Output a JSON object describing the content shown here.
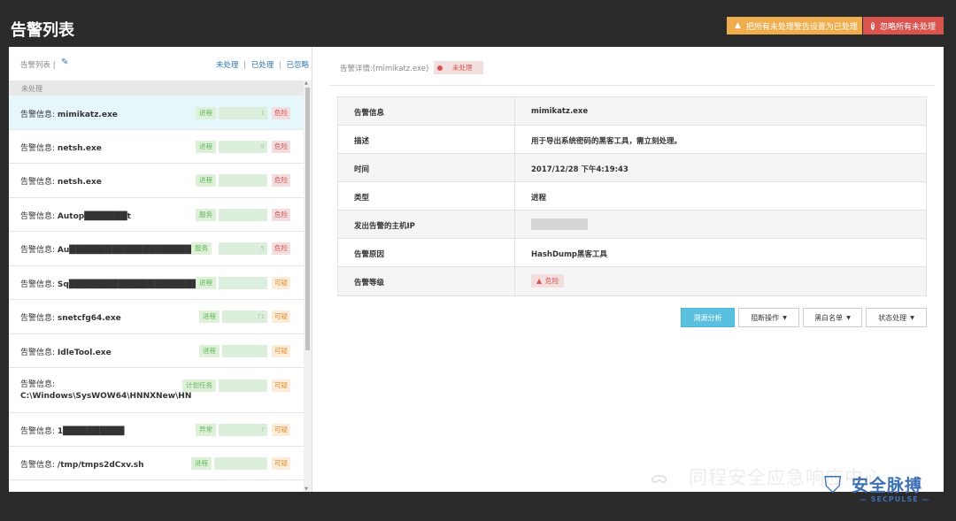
{
  "page": {
    "title": "告警列表"
  },
  "top_buttons": {
    "mark_all": "把所有未处理警告设置为已处理",
    "ignore_all": "忽略所有未处理"
  },
  "left": {
    "title": "告警列表 |",
    "filters": {
      "unhandled": "未处理",
      "handled": "已处理",
      "ignored": "已忽略",
      "sep": "|"
    },
    "section": "未处理",
    "items": [
      {
        "prefix": "告警信息: ",
        "name": "mimikatz.exe",
        "type": "进程",
        "blur_text": "1",
        "level": "危险",
        "level_kind": "high"
      },
      {
        "prefix": "告警信息: ",
        "name": "netsh.exe",
        "type": "进程",
        "blur_text": "9",
        "level": "危险",
        "level_kind": "high"
      },
      {
        "prefix": "告警信息: ",
        "name": "netsh.exe",
        "type": "进程",
        "blur_text": "",
        "level": "危险",
        "level_kind": "high"
      },
      {
        "prefix": "告警信息: ",
        "name": "Autop███████t",
        "type": "服务",
        "blur_text": "",
        "level": "危险",
        "level_kind": "high"
      },
      {
        "prefix": "告警信息: ",
        "name": "Au████████████████████g",
        "type": "服务",
        "blur_text": "5",
        "level": "危险",
        "level_kind": "high"
      },
      {
        "prefix": "告警信息: ",
        "name": "Sq██████████████████████e",
        "type": "进程",
        "blur_text": "",
        "level": "可疑",
        "level_kind": "mid"
      },
      {
        "prefix": "告警信息: ",
        "name": "snetcfg64.exe",
        "type": "进程",
        "blur_text": "71",
        "level": "可疑",
        "level_kind": "mid"
      },
      {
        "prefix": "告警信息: ",
        "name": "IdleTool.exe",
        "type": "进程",
        "blur_text": "",
        "level": "可疑",
        "level_kind": "mid"
      },
      {
        "prefix": "告警信息: ",
        "name": "C:\\Windows\\SysWOW64\\HNNXNew\\HN",
        "type": "计划任务",
        "blur_text": "",
        "level": "可疑",
        "level_kind": "mid"
      },
      {
        "prefix": "告警信息: ",
        "name": "1██████████",
        "type": "异常",
        "blur_text": "7",
        "level": "可疑",
        "level_kind": "mid"
      },
      {
        "prefix": "告警信息: ",
        "name": "/tmp/tmps2dCxv.sh",
        "type": "进程",
        "blur_text": "",
        "level": "可疑",
        "level_kind": "mid"
      }
    ]
  },
  "detail": {
    "header": "告警详情:(mimikatz.exe)",
    "status": "未处理",
    "rows": [
      {
        "key": "告警信息",
        "value": "mimikatz.exe"
      },
      {
        "key": "描述",
        "value": "用于导出系统密码的黑客工具，需立刻处理。"
      },
      {
        "key": "时间",
        "value": "2017/12/28 下午4:19:43"
      },
      {
        "key": "类型",
        "value": "进程"
      },
      {
        "key": "发出告警的主机IP",
        "value": ""
      },
      {
        "key": "告警原因",
        "value": "HashDump黑客工具"
      },
      {
        "key": "告警等级",
        "value": "危险"
      }
    ],
    "actions": {
      "trace": "溯源分析",
      "block": "阻断操作",
      "list": "黑白名单",
      "status": "状态处理"
    }
  },
  "watermark": {
    "text": "同程安全应急响应中心"
  },
  "brand": {
    "name": "安全脉搏",
    "sub": "— SECPULSE —"
  },
  "colors": {
    "warn": "#f0ad4e",
    "danger": "#d9534f",
    "info": "#5bc0de",
    "success": "#5cb85c"
  }
}
